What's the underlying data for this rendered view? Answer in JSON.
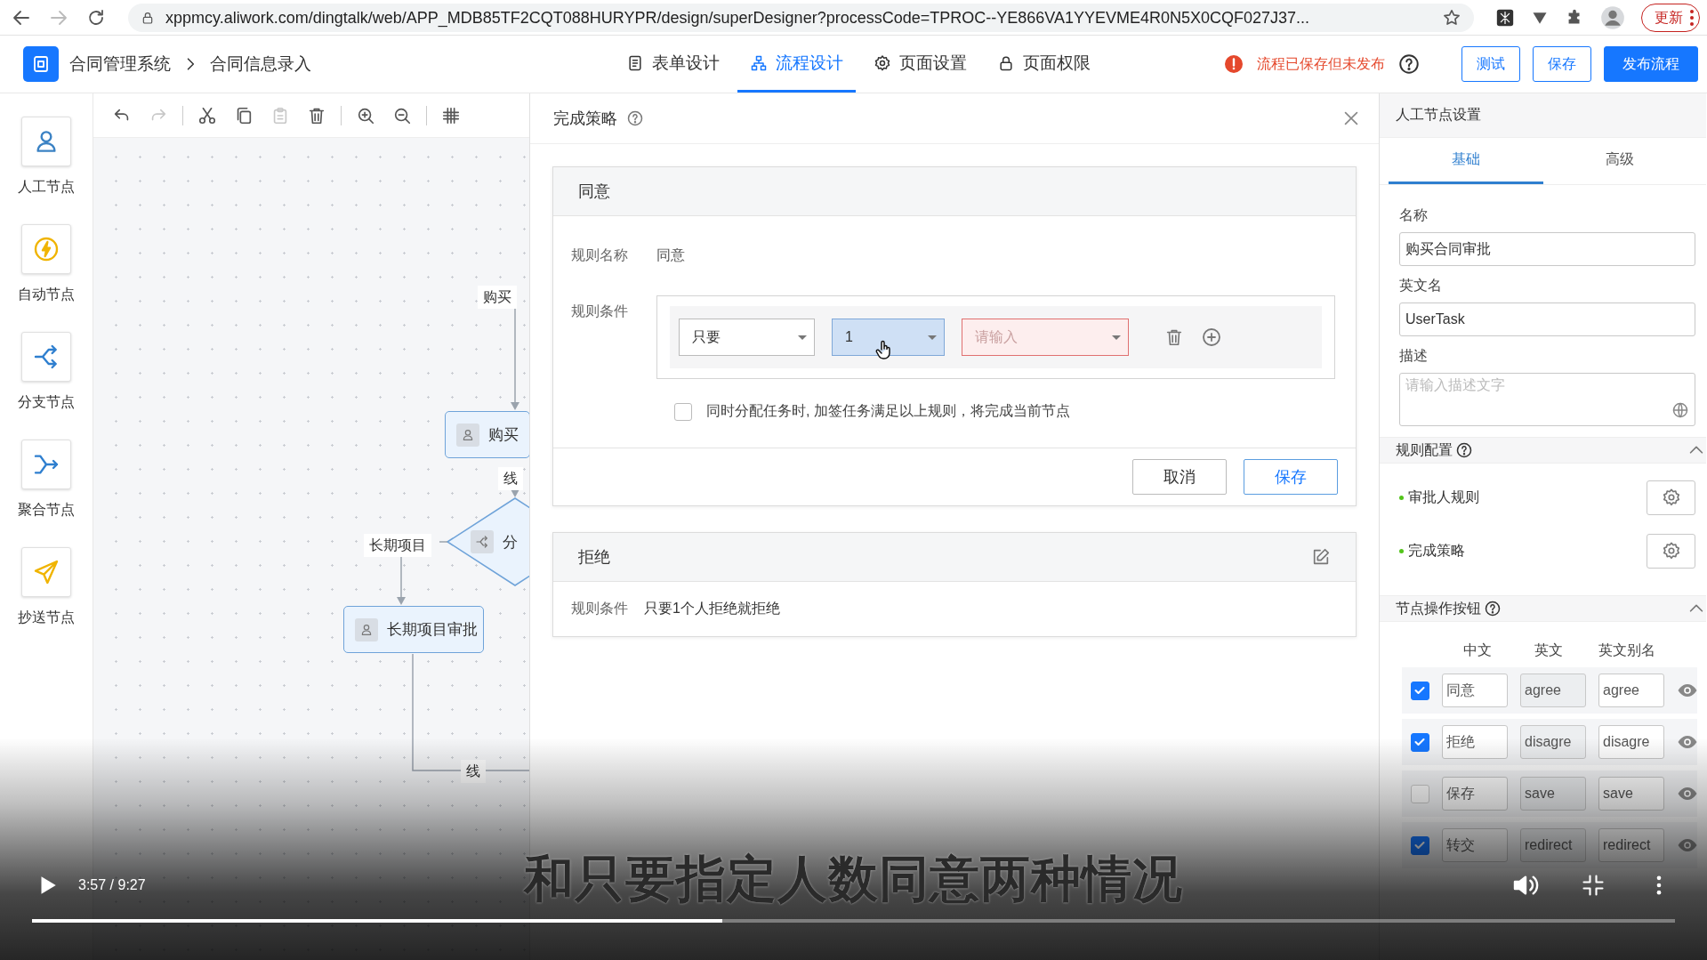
{
  "browser": {
    "url": "xppmcy.aliwork.com/dingtalk/web/APP_MDB85TF2CQT088HURYPR/design/superDesigner?processCode=TPROC--YE866VA1YYEVME4R0N5X0CQF027J37...",
    "update_label": "更新"
  },
  "header": {
    "breadcrumbs": [
      "合同管理系统",
      "合同信息录入"
    ],
    "tabs": [
      {
        "label": "表单设计",
        "selected": false
      },
      {
        "label": "流程设计",
        "selected": true
      },
      {
        "label": "页面设置",
        "selected": false
      },
      {
        "label": "页面权限",
        "selected": false
      }
    ],
    "status": "流程已保存但未发布",
    "buttons": [
      {
        "label": "测试",
        "kind": "outline"
      },
      {
        "label": "保存",
        "kind": "outline"
      },
      {
        "label": "发布流程",
        "kind": "primary"
      }
    ]
  },
  "palette": [
    {
      "kind": "manual",
      "label": "人工节点"
    },
    {
      "kind": "auto",
      "label": "自动节点"
    },
    {
      "kind": "branch",
      "label": "分支节点"
    },
    {
      "kind": "merge",
      "label": "聚合节点"
    },
    {
      "kind": "cc",
      "label": "抄送节点"
    }
  ],
  "toolbar": {
    "groups": [
      {
        "tools": [
          {
            "kind": "undo",
            "disabled": false
          },
          {
            "kind": "redo",
            "disabled": true
          }
        ]
      },
      {
        "tools": [
          {
            "kind": "cut",
            "disabled": false
          },
          {
            "kind": "copy",
            "disabled": false
          },
          {
            "kind": "paste",
            "disabled": true
          },
          {
            "kind": "delete",
            "disabled": false
          }
        ]
      },
      {
        "tools": [
          {
            "kind": "zoom_in",
            "disabled": false
          },
          {
            "kind": "zoom_out",
            "disabled": false
          }
        ]
      },
      {
        "tools": [
          {
            "kind": "grid",
            "disabled": false
          }
        ]
      }
    ]
  },
  "flow": {
    "nodes": [
      {
        "kind": "task",
        "label": "购买"
      },
      {
        "kind": "branch",
        "label": "分"
      },
      {
        "kind": "task",
        "label": "长期项目审批"
      }
    ],
    "edge_labels": [
      "购买",
      "线",
      "长期项目",
      "线"
    ]
  },
  "dialog": {
    "title": "完成策略",
    "agree": {
      "title": "同意",
      "name_label": "规则名称",
      "name": "同意",
      "condition_label": "规则条件",
      "conditions": [
        {
          "value": "只要",
          "focused": false,
          "invalid": false
        },
        {
          "value": "1",
          "focused": true,
          "invalid": false
        },
        {
          "placeholder": "请输入",
          "focused": false,
          "invalid": true
        }
      ],
      "option": {
        "label": "同时分配任务时, 加签任务满足以上规则，将完成当前节点",
        "checked": false
      },
      "cancel": "取消",
      "save": "保存"
    },
    "reject": {
      "title": "拒绝",
      "condition_label": "规则条件",
      "condition": "只要1个人拒绝就拒绝"
    }
  },
  "panel": {
    "title": "人工节点设置",
    "tabs": [
      {
        "label": "基础",
        "selected": true
      },
      {
        "label": "高级",
        "selected": false
      }
    ],
    "fields": [
      {
        "kind": "input",
        "label": "名称",
        "value": "购买合同审批"
      },
      {
        "kind": "input",
        "label": "英文名",
        "value": "UserTask"
      },
      {
        "kind": "textarea",
        "label": "描述",
        "placeholder": "请输入描述文字"
      }
    ],
    "rules": {
      "title": "规则配置",
      "items": [
        "审批人规则",
        "完成策略"
      ]
    },
    "actions": {
      "title": "节点操作按钮",
      "columns": [
        "中文",
        "英文",
        "英文别名"
      ],
      "rows": [
        {
          "checked": true,
          "zh": "同意",
          "en": "agree",
          "alias": "agree"
        },
        {
          "checked": true,
          "zh": "拒绝",
          "en": "disagre",
          "alias": "disagre"
        },
        {
          "checked": false,
          "zh": "保存",
          "en": "save",
          "alias": "save"
        },
        {
          "checked": true,
          "zh": "转交",
          "en": "redirect",
          "alias": "redirect"
        }
      ]
    }
  },
  "video": {
    "subtitle": "和只要指定人数同意两种情况",
    "time": "3:57 / 9:27",
    "progress": {
      "level": 0.42
    }
  }
}
